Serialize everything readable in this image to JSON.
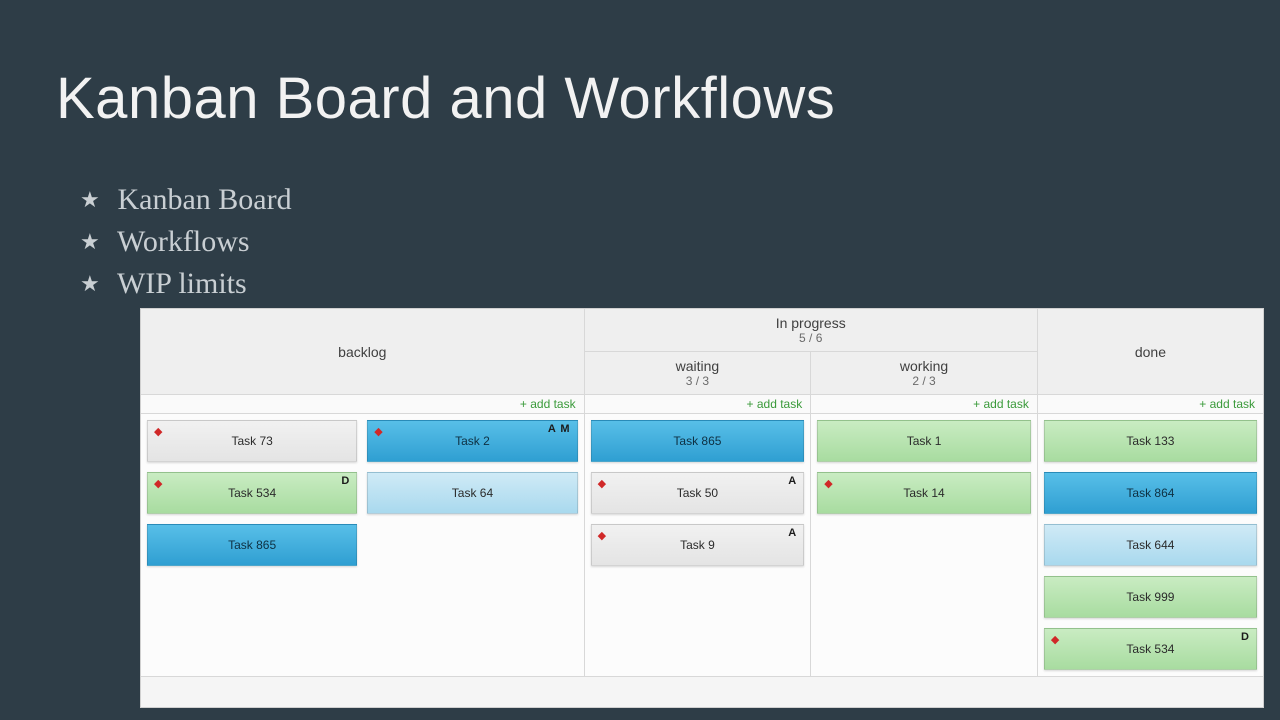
{
  "title": "Kanban Board and Workflows",
  "bullets": [
    "Kanban Board",
    "Workflows",
    "WIP limits"
  ],
  "board": {
    "add_task_label": "+ add task",
    "columns": {
      "backlog": {
        "title": "backlog"
      },
      "in_progress": {
        "title": "In progress",
        "wip": "5 / 6"
      },
      "waiting": {
        "title": "waiting",
        "wip": "3 / 3"
      },
      "working": {
        "title": "working",
        "wip": "2 / 3"
      },
      "done": {
        "title": "done"
      }
    },
    "cards": {
      "backlog": [
        {
          "label": "Task 73",
          "color": "gray",
          "pin": true,
          "tag": ""
        },
        {
          "label": "Task 2",
          "color": "blue",
          "pin": true,
          "tag": "A M"
        },
        {
          "label": "Task 534",
          "color": "green",
          "pin": true,
          "tag": "D"
        },
        {
          "label": "Task 64",
          "color": "ltblue",
          "pin": false,
          "tag": ""
        },
        {
          "label": "Task 865",
          "color": "blue",
          "pin": false,
          "tag": ""
        }
      ],
      "waiting": [
        {
          "label": "Task 865",
          "color": "blue",
          "pin": false,
          "tag": ""
        },
        {
          "label": "Task 50",
          "color": "gray",
          "pin": true,
          "tag": "A"
        },
        {
          "label": "Task 9",
          "color": "gray",
          "pin": true,
          "tag": "A"
        }
      ],
      "working": [
        {
          "label": "Task 1",
          "color": "green",
          "pin": false,
          "tag": ""
        },
        {
          "label": "Task 14",
          "color": "green",
          "pin": true,
          "tag": ""
        }
      ],
      "done": [
        {
          "label": "Task 133",
          "color": "green",
          "pin": false,
          "tag": ""
        },
        {
          "label": "Task 864",
          "color": "blue",
          "pin": false,
          "tag": ""
        },
        {
          "label": "Task 644",
          "color": "ltblue",
          "pin": false,
          "tag": ""
        },
        {
          "label": "Task 999",
          "color": "green",
          "pin": false,
          "tag": ""
        },
        {
          "label": "Task 534",
          "color": "green",
          "pin": true,
          "tag": "D"
        }
      ]
    }
  }
}
